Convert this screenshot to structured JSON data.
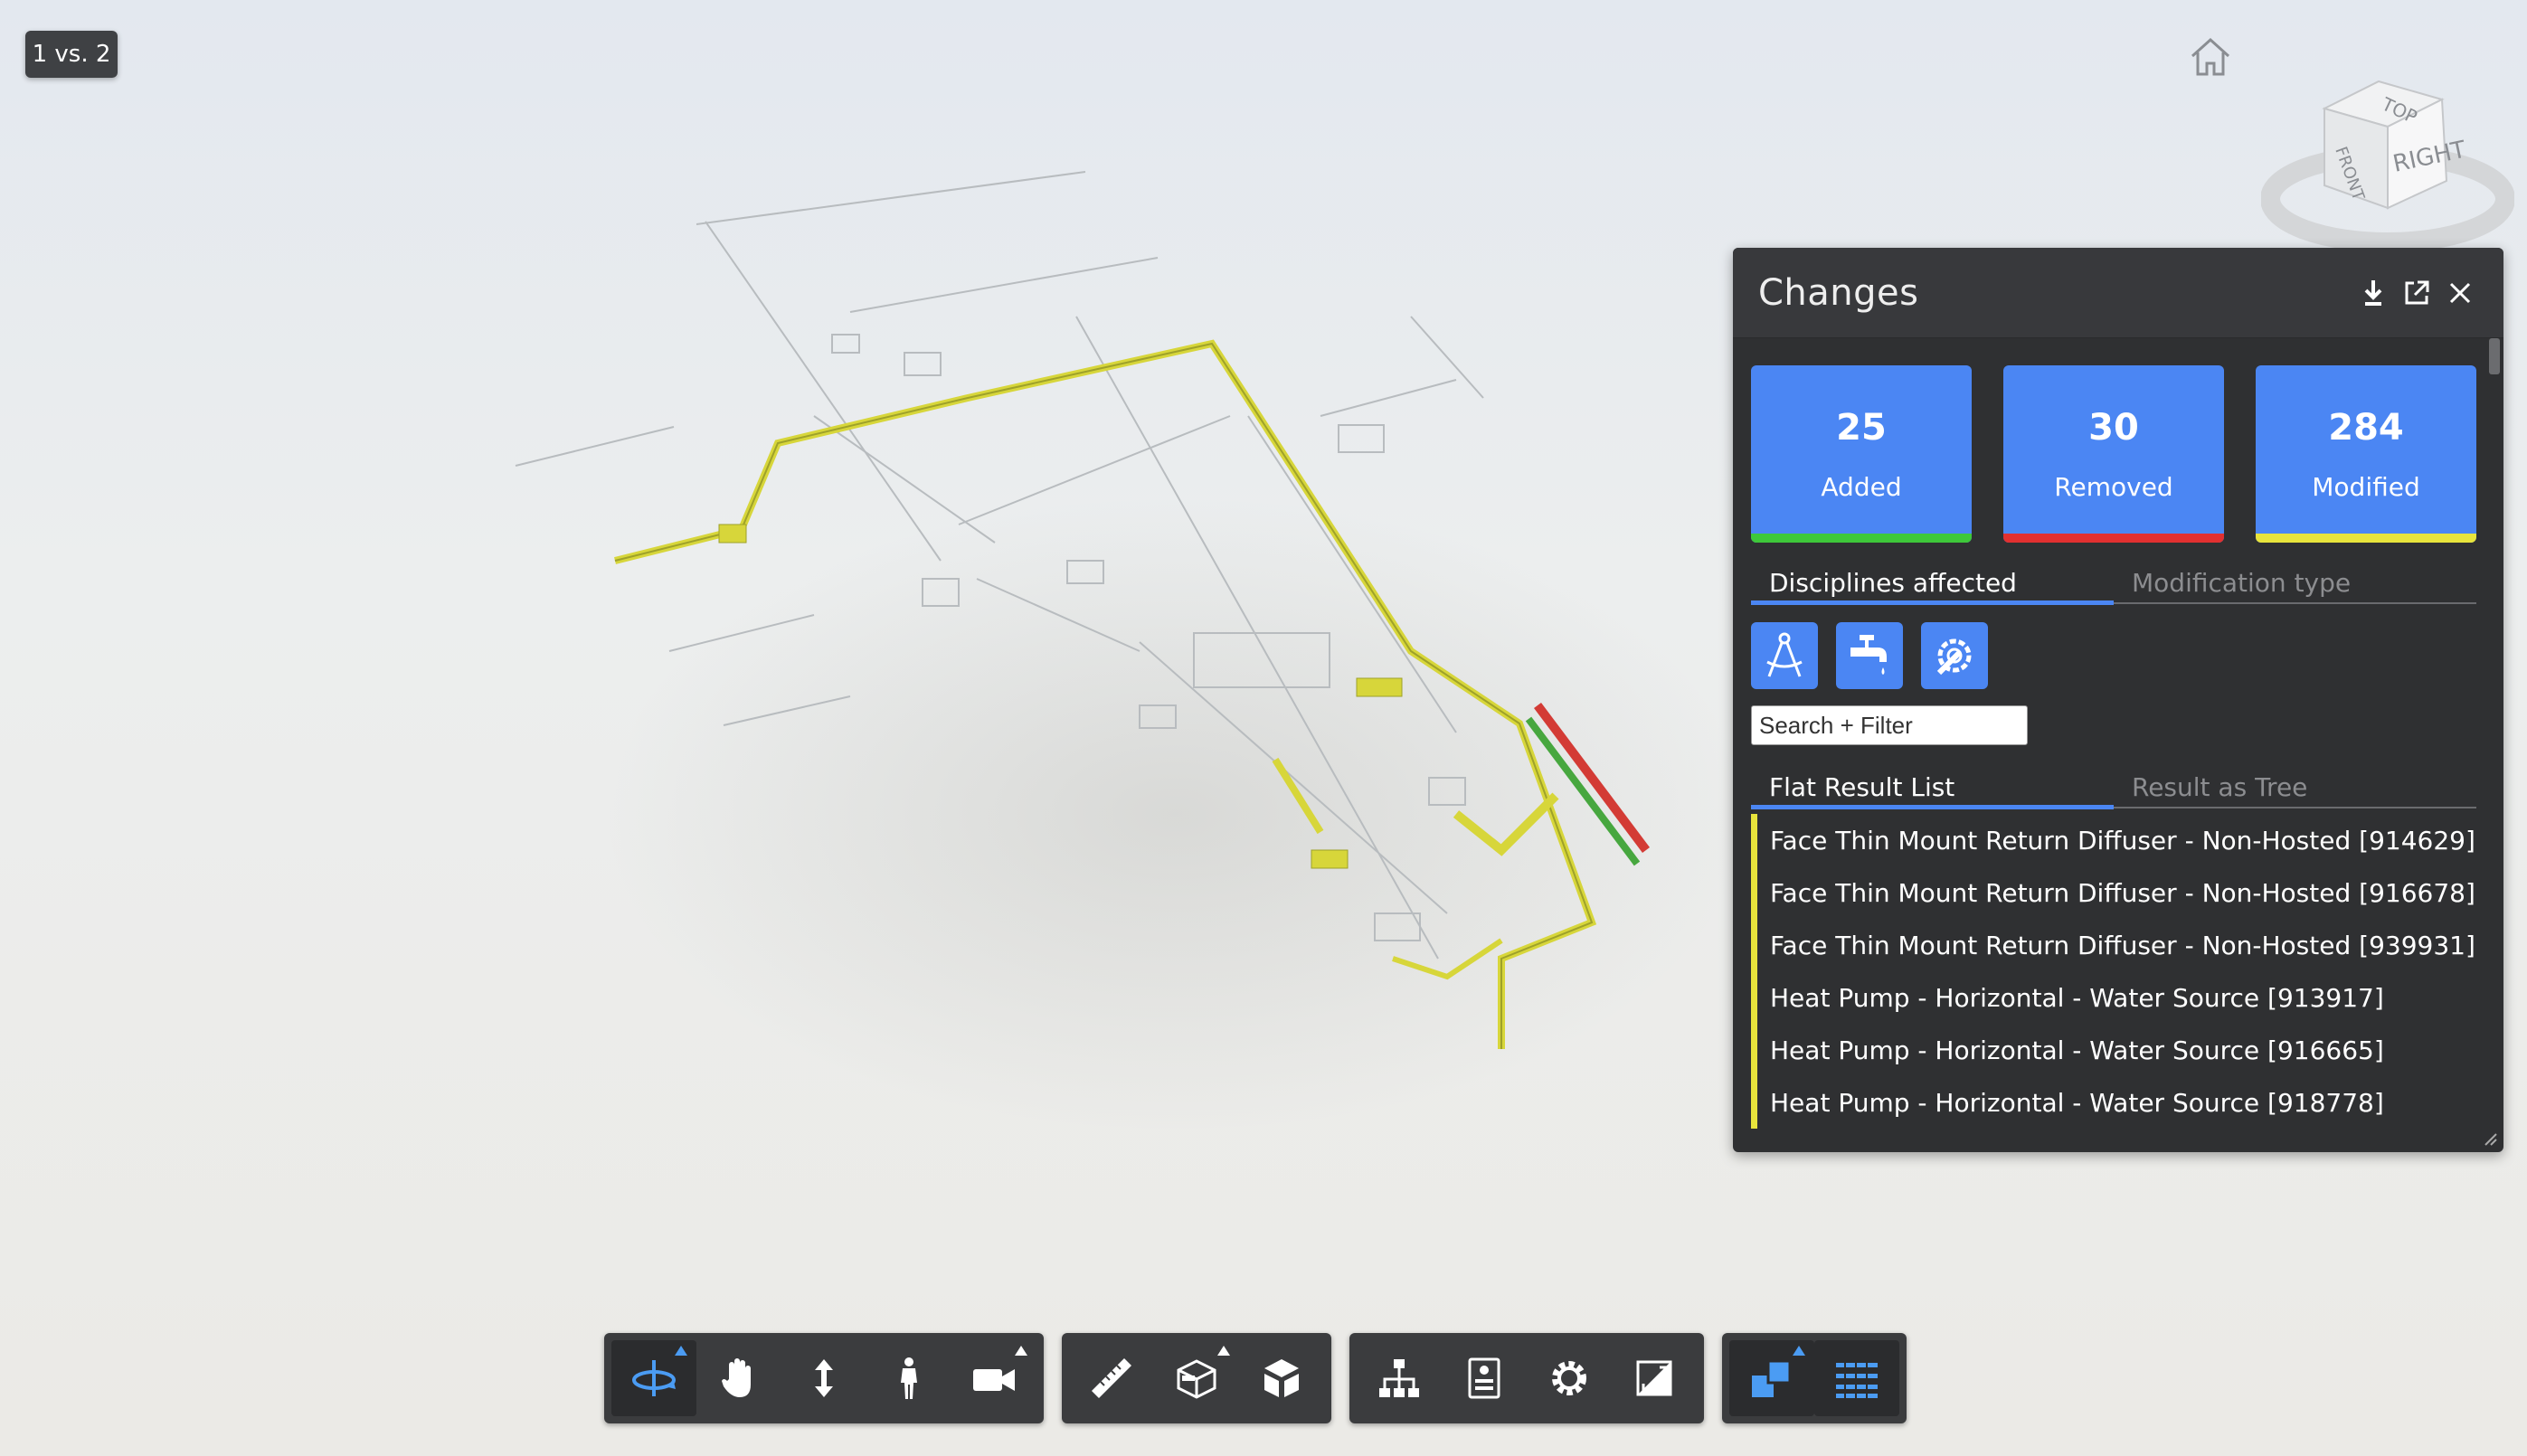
{
  "version_badge": "1 vs. 2",
  "panel": {
    "title": "Changes",
    "stats": [
      {
        "value": "25",
        "label": "Added",
        "bar_color": "#3ec83a"
      },
      {
        "value": "30",
        "label": "Removed",
        "bar_color": "#e23030"
      },
      {
        "value": "284",
        "label": "Modified",
        "bar_color": "#e8e43c"
      }
    ],
    "tabs_top": [
      {
        "label": "Disciplines affected",
        "active": true
      },
      {
        "label": "Modification type",
        "active": false
      }
    ],
    "discipline_icons": [
      "architecture-icon",
      "plumbing-icon",
      "mechanical-icon"
    ],
    "search": {
      "placeholder": "Search + Filter",
      "value": ""
    },
    "tabs_list": [
      {
        "label": "Flat Result List",
        "active": true
      },
      {
        "label": "Result as Tree",
        "active": false
      }
    ],
    "results": [
      "Face Thin Mount Return Diffuser - Non-Hosted [914629]",
      "Face Thin Mount Return Diffuser - Non-Hosted [916678]",
      "Face Thin Mount Return Diffuser - Non-Hosted [939931]",
      "Heat Pump - Horizontal - Water Source [913917]",
      "Heat Pump - Horizontal - Water Source [916665]",
      "Heat Pump - Horizontal - Water Source [918778]"
    ],
    "modified_color": "#e8e43c"
  },
  "viewcube": {
    "faces": [
      "TOP",
      "FRONT",
      "RIGHT"
    ]
  },
  "toolbar": {
    "groups": [
      [
        "orbit-icon",
        "pan-icon",
        "zoom-icon",
        "first-person-icon",
        "camera-icon"
      ],
      [
        "measure-icon",
        "section-icon",
        "explode-icon"
      ],
      [
        "model-browser-icon",
        "properties-icon",
        "settings-icon",
        "fullscreen-icon"
      ],
      [
        "diff-icon",
        "list-icon"
      ]
    ]
  },
  "colors": {
    "accent": "#4b86f3",
    "panel_bg": "#2f3032",
    "toolbar_bg": "#3b3c3e"
  }
}
